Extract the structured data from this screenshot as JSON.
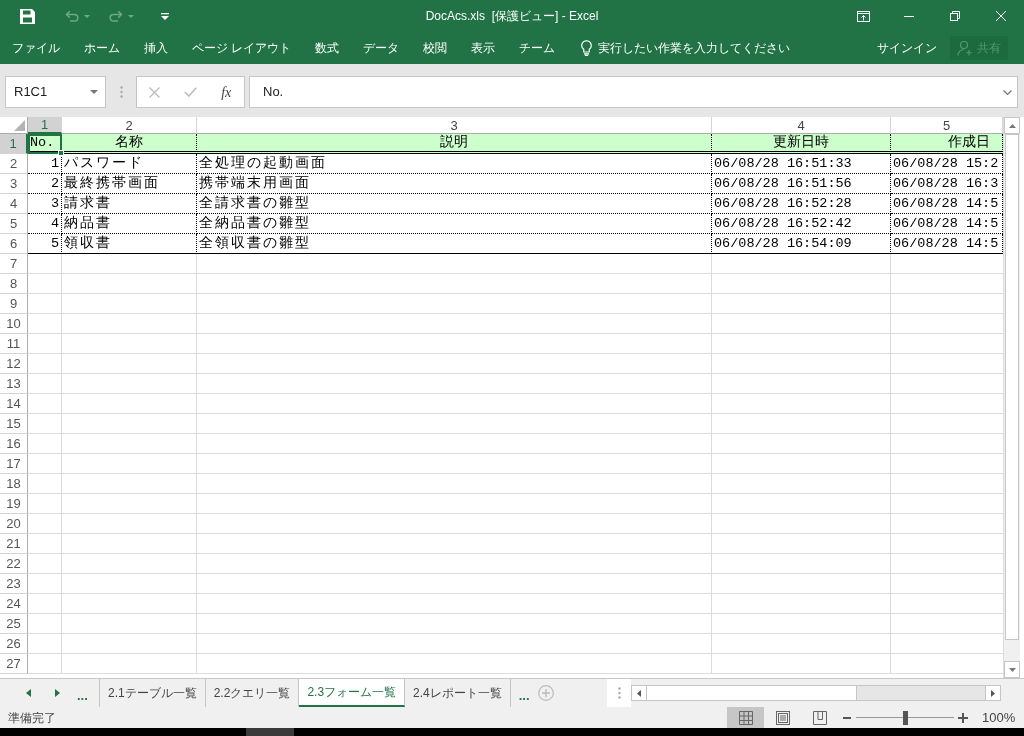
{
  "title_bar": {
    "title": "DocAcs.xls  [保護ビュー] - Excel",
    "quick_access": [
      {
        "kind": "save",
        "disabled": false
      },
      {
        "kind": "undo",
        "disabled": true
      },
      {
        "kind": "redo",
        "disabled": true
      },
      {
        "kind": "customize",
        "disabled": false
      }
    ]
  },
  "ribbon": {
    "tabs": [
      "ファイル",
      "ホーム",
      "挿入",
      "ページ レイアウト",
      "数式",
      "データ",
      "校閲",
      "表示",
      "チーム"
    ],
    "tell_me": {
      "placeholder": "実行したい作業を入力してください"
    },
    "sign_in": "サインイン",
    "share": {
      "label": "共有",
      "disabled": true
    }
  },
  "formula_bar": {
    "name_box": "R1C1",
    "buttons": [
      {
        "kind": "cancel",
        "disabled": true
      },
      {
        "kind": "enter",
        "disabled": true
      }
    ],
    "function_button": "fx",
    "value": "No."
  },
  "sheet": {
    "columns": [
      {
        "label": "1",
        "selected": true
      },
      {
        "label": "2",
        "selected": false
      },
      {
        "label": "3",
        "selected": false
      },
      {
        "label": "4",
        "selected": false
      },
      {
        "label": "5",
        "selected": false
      }
    ],
    "rows": [
      {
        "label": "1",
        "selected": true,
        "kind": "header",
        "cells": [
          "No.",
          "名称",
          "説明",
          "更新日時",
          "作成日"
        ]
      },
      {
        "label": "2",
        "selected": false,
        "kind": "data",
        "cells": [
          "1",
          "パスワード",
          "全処理の起動画面",
          "06/08/28 16:51:33",
          "06/08/28 15:2"
        ]
      },
      {
        "label": "3",
        "selected": false,
        "kind": "data",
        "cells": [
          "2",
          "最終携帯画面",
          "携帯端末用画面",
          "06/08/28 16:51:56",
          "06/08/28 16:3"
        ]
      },
      {
        "label": "4",
        "selected": false,
        "kind": "data",
        "cells": [
          "3",
          "請求書",
          "全請求書の雛型",
          "06/08/28 16:52:28",
          "06/08/28 14:5"
        ]
      },
      {
        "label": "5",
        "selected": false,
        "kind": "data",
        "cells": [
          "4",
          "納品書",
          "全納品書の雛型",
          "06/08/28 16:52:42",
          "06/08/28 14:5"
        ]
      },
      {
        "label": "6",
        "selected": false,
        "kind": "data",
        "cells": [
          "5",
          "領収書",
          "全領収書の雛型",
          "06/08/28 16:54:09",
          "06/08/28 14:5"
        ]
      },
      {
        "label": "7",
        "selected": false,
        "kind": "blank"
      },
      {
        "label": "8",
        "selected": false,
        "kind": "blank"
      },
      {
        "label": "9",
        "selected": false,
        "kind": "blank"
      },
      {
        "label": "10",
        "selected": false,
        "kind": "blank"
      },
      {
        "label": "11",
        "selected": false,
        "kind": "blank"
      },
      {
        "label": "12",
        "selected": false,
        "kind": "blank"
      },
      {
        "label": "13",
        "selected": false,
        "kind": "blank"
      },
      {
        "label": "14",
        "selected": false,
        "kind": "blank"
      },
      {
        "label": "15",
        "selected": false,
        "kind": "blank"
      },
      {
        "label": "16",
        "selected": false,
        "kind": "blank"
      },
      {
        "label": "17",
        "selected": false,
        "kind": "blank"
      },
      {
        "label": "18",
        "selected": false,
        "kind": "blank"
      },
      {
        "label": "19",
        "selected": false,
        "kind": "blank"
      },
      {
        "label": "20",
        "selected": false,
        "kind": "blank"
      },
      {
        "label": "21",
        "selected": false,
        "kind": "blank"
      },
      {
        "label": "22",
        "selected": false,
        "kind": "blank"
      },
      {
        "label": "23",
        "selected": false,
        "kind": "blank"
      },
      {
        "label": "24",
        "selected": false,
        "kind": "blank"
      },
      {
        "label": "25",
        "selected": false,
        "kind": "blank"
      },
      {
        "label": "26",
        "selected": false,
        "kind": "blank"
      },
      {
        "label": "27",
        "selected": false,
        "kind": "blank"
      }
    ]
  },
  "sheet_tabs": {
    "overflow_left": "...",
    "tabs": [
      {
        "label": "2.1テーブル一覧",
        "selected": false
      },
      {
        "label": "2.2クエリ一覧",
        "selected": false
      },
      {
        "label": "2.3フォーム一覧",
        "selected": true
      },
      {
        "label": "2.4レポート一覧",
        "selected": false
      }
    ],
    "overflow_right": "..."
  },
  "status_bar": {
    "text": "準備完了",
    "views": [
      {
        "kind": "normal",
        "selected": true
      },
      {
        "kind": "page_layout",
        "selected": false
      },
      {
        "kind": "page_break",
        "selected": false
      }
    ],
    "zoom": {
      "level": 0.5,
      "reading": "100%"
    }
  }
}
